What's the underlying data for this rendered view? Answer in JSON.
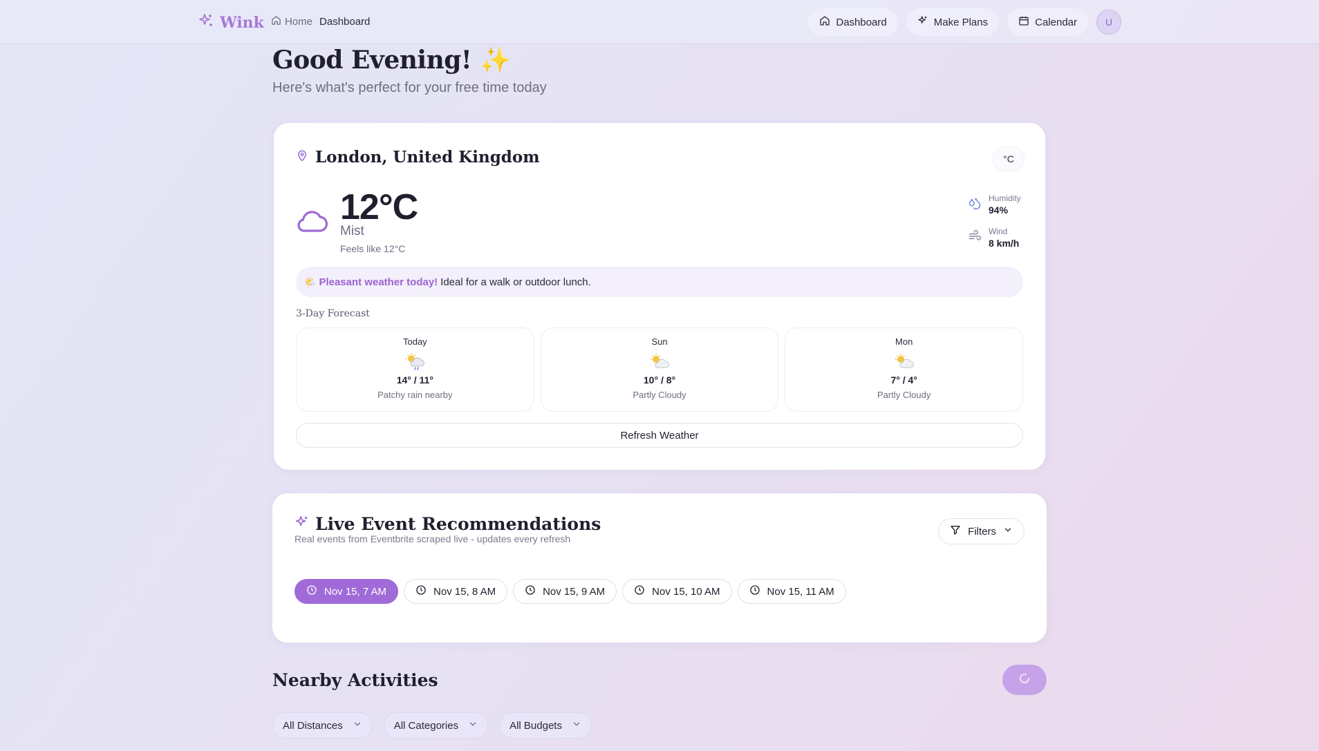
{
  "app": {
    "name": "Wink",
    "logo_icon": "sparkles-icon",
    "accent": "#a06ad8"
  },
  "breadcrumb": {
    "home": "Home",
    "current": "Dashboard"
  },
  "nav": {
    "dashboard": "Dashboard",
    "make_plans": "Make Plans",
    "calendar": "Calendar",
    "avatar_initial": "U"
  },
  "greeting": {
    "title": "Good Evening!",
    "emoji": "✨",
    "subtitle": "Here's what's perfect for your free time today"
  },
  "weather": {
    "location": "London, United Kingdom",
    "unit_toggle": "°C",
    "temperature": "12°C",
    "condition": "Mist",
    "feels_like": "Feels like 12°C",
    "humidity_label": "Humidity",
    "humidity_value": "94%",
    "wind_label": "Wind",
    "wind_value": "8 km/h",
    "tip_emoji": "🌤️",
    "tip_strong": "Pleasant weather today!",
    "tip_text": "Ideal for a walk or outdoor lunch.",
    "forecast_title": "3-Day Forecast",
    "forecast": [
      {
        "day": "Today",
        "range": "14° / 11°",
        "desc": "Patchy rain nearby",
        "icon": "sun-rain-cloud-icon"
      },
      {
        "day": "Sun",
        "range": "10° / 8°",
        "desc": "Partly Cloudy",
        "icon": "partly-cloudy-icon"
      },
      {
        "day": "Mon",
        "range": "7° / 4°",
        "desc": "Partly Cloudy",
        "icon": "partly-cloudy-icon"
      }
    ],
    "refresh_label": "Refresh Weather"
  },
  "events": {
    "title": "Live Event Recommendations",
    "subtitle": "Real events from Eventbrite scraped live - updates every refresh",
    "filters_label": "Filters",
    "time_slots": [
      {
        "label": "Nov 15, 7 AM",
        "active": true
      },
      {
        "label": "Nov 15, 8 AM",
        "active": false
      },
      {
        "label": "Nov 15, 9 AM",
        "active": false
      },
      {
        "label": "Nov 15, 10 AM",
        "active": false
      },
      {
        "label": "Nov 15, 11 AM",
        "active": false
      }
    ]
  },
  "nearby": {
    "title": "Nearby Activities",
    "distance": "All Distances",
    "category": "All Categories",
    "budget": "All Budgets"
  }
}
